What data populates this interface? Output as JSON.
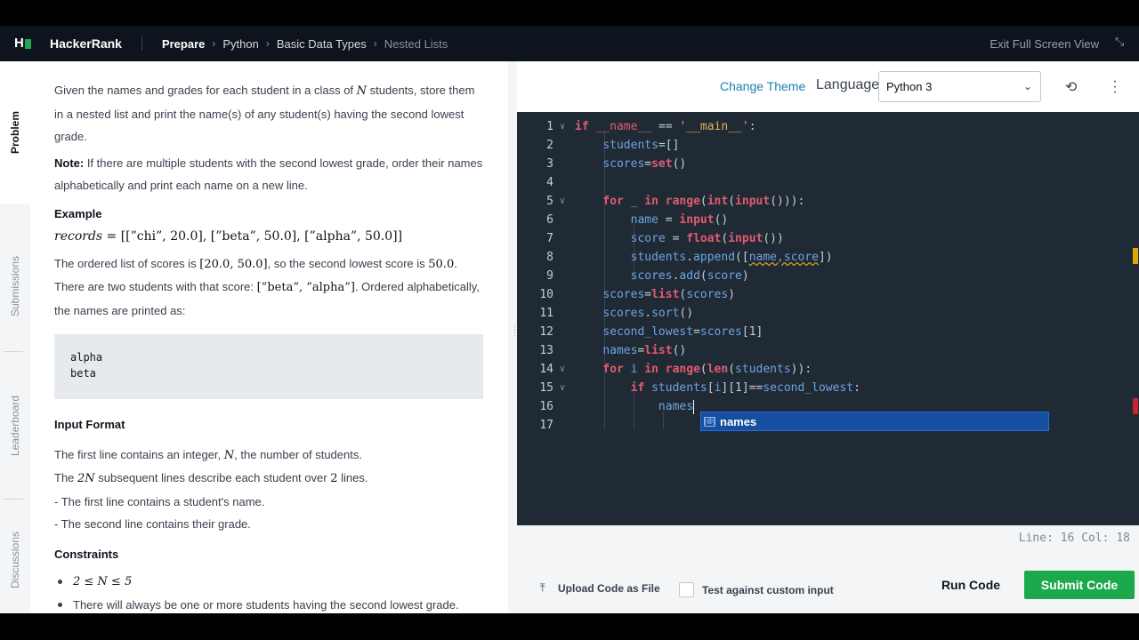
{
  "nav": {
    "brand": "HackerRank",
    "breadcrumb": [
      "Prepare",
      "Python",
      "Basic Data Types",
      "Nested Lists"
    ],
    "exit_fullscreen": "Exit Full Screen View"
  },
  "side_tabs": [
    "Problem",
    "Submissions",
    "Leaderboard",
    "Discussions"
  ],
  "problem": {
    "intro_a": "Given the names and grades for each student in a class of ",
    "intro_n": "N",
    "intro_b": " students, store them in a nested list and print the name(s) of any student(s) having the second lowest grade.",
    "note_label": "Note:",
    "note_text": " If there are multiple students with the second lowest grade, order their names alphabetically and print each name on a new line.",
    "example_heading": "Example",
    "records_var": "records",
    "records_value": " = [[”chi”, 20.0], [”beta”, 50.0], [”alpha”, 50.0]]",
    "scores_a": "The ordered list of scores is ",
    "scores_list": "[20.0, 50.0]",
    "scores_b": ", so the second lowest score is ",
    "scores_val": "50.0",
    "scores_c": ".",
    "two_a": "There are two students with that score: ",
    "two_list": "[”beta”, ”alpha”]",
    "two_b": ". Ordered alphabetically, the names are printed as:",
    "sample_output": [
      "alpha",
      "beta"
    ],
    "input_heading": "Input Format",
    "input_1a": "The first line contains an integer, ",
    "input_1n": "N",
    "input_1b": ", the number of students.",
    "input_2a": "The ",
    "input_2n": "2N",
    "input_2b": " subsequent lines describe each student over ",
    "input_2c": "2",
    "input_2d": " lines.",
    "input_3": "- The first line contains a student's name.",
    "input_4": "- The second line contains their grade.",
    "constraints_heading": "Constraints",
    "constraint_1": "2 ≤ N ≤ 5",
    "constraint_2": "There will always be one or more students having the second lowest grade."
  },
  "editor": {
    "change_theme": "Change Theme",
    "language_label": "Language",
    "language_selected": "Python 3",
    "line_numbers": [
      "1",
      "2",
      "3",
      "4",
      "5",
      "6",
      "7",
      "8",
      "9",
      "10",
      "11",
      "12",
      "13",
      "14",
      "15",
      "16",
      "17"
    ],
    "autocomplete_item": "names",
    "status": "Line: 16 Col: 18"
  },
  "actions": {
    "upload": "Upload Code as File",
    "custom_input": "Test against custom input",
    "run": "Run Code",
    "submit": "Submit Code"
  },
  "colors": {
    "accent_green": "#1ba94c",
    "nav_bg": "#0e141e",
    "editor_bg": "#1f2a35",
    "link_blue": "#1d7fb0"
  }
}
